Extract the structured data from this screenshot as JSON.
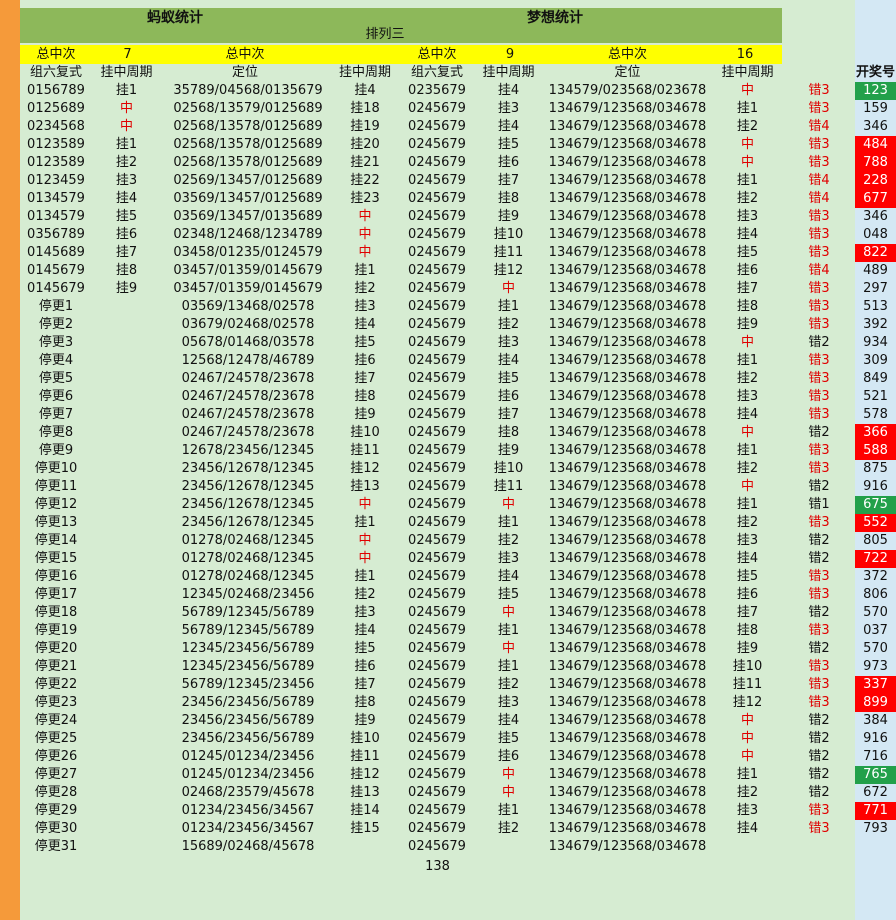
{
  "header": {
    "left_title": "蚂蚁统计",
    "right_title": "梦想统计",
    "subtitle": "排列三"
  },
  "summary": {
    "left_label": "总中次",
    "left_count": "7",
    "mid_label": "总中次",
    "right_label": "总中次",
    "right_count": "9",
    "far_label": "总中次",
    "far_count": "16"
  },
  "columns": {
    "ant_combo": "组六复式",
    "ant_cycle": "挂中周期",
    "ant_position": "定位",
    "ant_pos_cycle": "挂中周期",
    "dream_combo": "组六复式",
    "dream_cycle": "挂中周期",
    "dream_position": "定位",
    "dream_pos_cycle": "挂中周期",
    "result": "开奖号"
  },
  "rows": [
    {
      "a": "0156789",
      "b": "挂1",
      "c": "35789/04568/0135679",
      "d": "挂4",
      "e": "0235679",
      "f": "挂4",
      "g": "134579/023568/023678",
      "h": "中",
      "i": "错3",
      "r": "123",
      "rs": "g"
    },
    {
      "a": "0125689",
      "b": "中",
      "c": "02568/13579/0125689",
      "d": "挂18",
      "e": "0245679",
      "f": "挂3",
      "g": "134679/123568/034678",
      "h": "挂1",
      "i": "错3",
      "r": "159",
      "rs": ""
    },
    {
      "a": "0234568",
      "b": "中",
      "c": "02568/13578/0125689",
      "d": "挂19",
      "e": "0245679",
      "f": "挂4",
      "g": "134679/123568/034678",
      "h": "挂2",
      "i": "错4",
      "r": "346",
      "rs": ""
    },
    {
      "a": "0123589",
      "b": "挂1",
      "c": "02568/13578/0125689",
      "d": "挂20",
      "e": "0245679",
      "f": "挂5",
      "g": "134679/123568/034678",
      "h": "中",
      "i": "错3",
      "r": "484",
      "rs": "r"
    },
    {
      "a": "0123589",
      "b": "挂2",
      "c": "02568/13578/0125689",
      "d": "挂21",
      "e": "0245679",
      "f": "挂6",
      "g": "134679/123568/034678",
      "h": "中",
      "i": "错3",
      "r": "788",
      "rs": "r"
    },
    {
      "a": "0123459",
      "b": "挂3",
      "c": "02569/13457/0125689",
      "d": "挂22",
      "e": "0245679",
      "f": "挂7",
      "g": "134679/123568/034678",
      "h": "挂1",
      "i": "错4",
      "r": "228",
      "rs": "r"
    },
    {
      "a": "0134579",
      "b": "挂4",
      "c": "03569/13457/0125689",
      "d": "挂23",
      "e": "0245679",
      "f": "挂8",
      "g": "134679/123568/034678",
      "h": "挂2",
      "i": "错4",
      "r": "677",
      "rs": "r"
    },
    {
      "a": "0134579",
      "b": "挂5",
      "c": "03569/13457/0135689",
      "d": "中",
      "e": "0245679",
      "f": "挂9",
      "g": "134679/123568/034678",
      "h": "挂3",
      "i": "错3",
      "r": "346",
      "rs": ""
    },
    {
      "a": "0356789",
      "b": "挂6",
      "c": "02348/12468/1234789",
      "d": "中",
      "e": "0245679",
      "f": "挂10",
      "g": "134679/123568/034678",
      "h": "挂4",
      "i": "错3",
      "r": "048",
      "rs": ""
    },
    {
      "a": "0145689",
      "b": "挂7",
      "c": "03458/01235/0124579",
      "d": "中",
      "e": "0245679",
      "f": "挂11",
      "g": "134679/123568/034678",
      "h": "挂5",
      "i": "错3",
      "r": "822",
      "rs": "r"
    },
    {
      "a": "0145679",
      "b": "挂8",
      "c": "03457/01359/0145679",
      "d": "挂1",
      "e": "0245679",
      "f": "挂12",
      "g": "134679/123568/034678",
      "h": "挂6",
      "i": "错4",
      "r": "489",
      "rs": ""
    },
    {
      "a": "0145679",
      "b": "挂9",
      "c": "03457/01359/0145679",
      "d": "挂2",
      "e": "0245679",
      "f": "中",
      "g": "134679/123568/034678",
      "h": "挂7",
      "i": "错3",
      "r": "297",
      "rs": ""
    },
    {
      "a": "停更1",
      "b": "",
      "c": "03569/13468/02578",
      "d": "挂3",
      "e": "0245679",
      "f": "挂1",
      "g": "134679/123568/034678",
      "h": "挂8",
      "i": "错3",
      "r": "513",
      "rs": ""
    },
    {
      "a": "停更2",
      "b": "",
      "c": "03679/02468/02578",
      "d": "挂4",
      "e": "0245679",
      "f": "挂2",
      "g": "134679/123568/034678",
      "h": "挂9",
      "i": "错3",
      "r": "392",
      "rs": ""
    },
    {
      "a": "停更3",
      "b": "",
      "c": "05678/01468/03578",
      "d": "挂5",
      "e": "0245679",
      "f": "挂3",
      "g": "134679/123568/034678",
      "h": "中",
      "i": "错2",
      "r": "934",
      "rs": ""
    },
    {
      "a": "停更4",
      "b": "",
      "c": "12568/12478/46789",
      "d": "挂6",
      "e": "0245679",
      "f": "挂4",
      "g": "134679/123568/034678",
      "h": "挂1",
      "i": "错3",
      "r": "309",
      "rs": ""
    },
    {
      "a": "停更5",
      "b": "",
      "c": "02467/24578/23678",
      "d": "挂7",
      "e": "0245679",
      "f": "挂5",
      "g": "134679/123568/034678",
      "h": "挂2",
      "i": "错3",
      "r": "849",
      "rs": ""
    },
    {
      "a": "停更6",
      "b": "",
      "c": "02467/24578/23678",
      "d": "挂8",
      "e": "0245679",
      "f": "挂6",
      "g": "134679/123568/034678",
      "h": "挂3",
      "i": "错3",
      "r": "521",
      "rs": ""
    },
    {
      "a": "停更7",
      "b": "",
      "c": "02467/24578/23678",
      "d": "挂9",
      "e": "0245679",
      "f": "挂7",
      "g": "134679/123568/034678",
      "h": "挂4",
      "i": "错3",
      "r": "578",
      "rs": ""
    },
    {
      "a": "停更8",
      "b": "",
      "c": "02467/24578/23678",
      "d": "挂10",
      "e": "0245679",
      "f": "挂8",
      "g": "134679/123568/034678",
      "h": "中",
      "i": "错2",
      "r": "366",
      "rs": "r"
    },
    {
      "a": "停更9",
      "b": "",
      "c": "12678/23456/12345",
      "d": "挂11",
      "e": "0245679",
      "f": "挂9",
      "g": "134679/123568/034678",
      "h": "挂1",
      "i": "错3",
      "r": "588",
      "rs": "r"
    },
    {
      "a": "停更10",
      "b": "",
      "c": "23456/12678/12345",
      "d": "挂12",
      "e": "0245679",
      "f": "挂10",
      "g": "134679/123568/034678",
      "h": "挂2",
      "i": "错3",
      "r": "875",
      "rs": ""
    },
    {
      "a": "停更11",
      "b": "",
      "c": "23456/12678/12345",
      "d": "挂13",
      "e": "0245679",
      "f": "挂11",
      "g": "134679/123568/034678",
      "h": "中",
      "i": "错2",
      "r": "916",
      "rs": ""
    },
    {
      "a": "停更12",
      "b": "",
      "c": "23456/12678/12345",
      "d": "中",
      "e": "0245679",
      "f": "中",
      "g": "134679/123568/034678",
      "h": "挂1",
      "i": "错1",
      "r": "675",
      "rs": "g"
    },
    {
      "a": "停更13",
      "b": "",
      "c": "23456/12678/12345",
      "d": "挂1",
      "e": "0245679",
      "f": "挂1",
      "g": "134679/123568/034678",
      "h": "挂2",
      "i": "错3",
      "r": "552",
      "rs": "r"
    },
    {
      "a": "停更14",
      "b": "",
      "c": "01278/02468/12345",
      "d": "中",
      "e": "0245679",
      "f": "挂2",
      "g": "134679/123568/034678",
      "h": "挂3",
      "i": "错2",
      "r": "805",
      "rs": ""
    },
    {
      "a": "停更15",
      "b": "",
      "c": "01278/02468/12345",
      "d": "中",
      "e": "0245679",
      "f": "挂3",
      "g": "134679/123568/034678",
      "h": "挂4",
      "i": "错2",
      "r": "722",
      "rs": "r"
    },
    {
      "a": "停更16",
      "b": "",
      "c": "01278/02468/12345",
      "d": "挂1",
      "e": "0245679",
      "f": "挂4",
      "g": "134679/123568/034678",
      "h": "挂5",
      "i": "错3",
      "r": "372",
      "rs": ""
    },
    {
      "a": "停更17",
      "b": "",
      "c": "12345/02468/23456",
      "d": "挂2",
      "e": "0245679",
      "f": "挂5",
      "g": "134679/123568/034678",
      "h": "挂6",
      "i": "错3",
      "r": "806",
      "rs": ""
    },
    {
      "a": "停更18",
      "b": "",
      "c": "56789/12345/56789",
      "d": "挂3",
      "e": "0245679",
      "f": "中",
      "g": "134679/123568/034678",
      "h": "挂7",
      "i": "错2",
      "r": "570",
      "rs": ""
    },
    {
      "a": "停更19",
      "b": "",
      "c": "56789/12345/56789",
      "d": "挂4",
      "e": "0245679",
      "f": "挂1",
      "g": "134679/123568/034678",
      "h": "挂8",
      "i": "错3",
      "r": "037",
      "rs": ""
    },
    {
      "a": "停更20",
      "b": "",
      "c": "12345/23456/56789",
      "d": "挂5",
      "e": "0245679",
      "f": "中",
      "g": "134679/123568/034678",
      "h": "挂9",
      "i": "错2",
      "r": "570",
      "rs": ""
    },
    {
      "a": "停更21",
      "b": "",
      "c": "12345/23456/56789",
      "d": "挂6",
      "e": "0245679",
      "f": "挂1",
      "g": "134679/123568/034678",
      "h": "挂10",
      "i": "错3",
      "r": "973",
      "rs": ""
    },
    {
      "a": "停更22",
      "b": "",
      "c": "56789/12345/23456",
      "d": "挂7",
      "e": "0245679",
      "f": "挂2",
      "g": "134679/123568/034678",
      "h": "挂11",
      "i": "错3",
      "r": "337",
      "rs": "r"
    },
    {
      "a": "停更23",
      "b": "",
      "c": "23456/23456/56789",
      "d": "挂8",
      "e": "0245679",
      "f": "挂3",
      "g": "134679/123568/034678",
      "h": "挂12",
      "i": "错3",
      "r": "899",
      "rs": "r"
    },
    {
      "a": "停更24",
      "b": "",
      "c": "23456/23456/56789",
      "d": "挂9",
      "e": "0245679",
      "f": "挂4",
      "g": "134679/123568/034678",
      "h": "中",
      "i": "错2",
      "r": "384",
      "rs": ""
    },
    {
      "a": "停更25",
      "b": "",
      "c": "23456/23456/56789",
      "d": "挂10",
      "e": "0245679",
      "f": "挂5",
      "g": "134679/123568/034678",
      "h": "中",
      "i": "错2",
      "r": "916",
      "rs": ""
    },
    {
      "a": "停更26",
      "b": "",
      "c": "01245/01234/23456",
      "d": "挂11",
      "e": "0245679",
      "f": "挂6",
      "g": "134679/123568/034678",
      "h": "中",
      "i": "错2",
      "r": "716",
      "rs": ""
    },
    {
      "a": "停更27",
      "b": "",
      "c": "01245/01234/23456",
      "d": "挂12",
      "e": "0245679",
      "f": "中",
      "g": "134679/123568/034678",
      "h": "挂1",
      "i": "错2",
      "r": "765",
      "rs": "g"
    },
    {
      "a": "停更28",
      "b": "",
      "c": "02468/23579/45678",
      "d": "挂13",
      "e": "0245679",
      "f": "中",
      "g": "134679/123568/034678",
      "h": "挂2",
      "i": "错2",
      "r": "672",
      "rs": ""
    },
    {
      "a": "停更29",
      "b": "",
      "c": "01234/23456/34567",
      "d": "挂14",
      "e": "0245679",
      "f": "挂1",
      "g": "134679/123568/034678",
      "h": "挂3",
      "i": "错3",
      "r": "771",
      "rs": "r"
    },
    {
      "a": "停更30",
      "b": "",
      "c": "01234/23456/34567",
      "d": "挂15",
      "e": "0245679",
      "f": "挂2",
      "g": "134679/123568/034678",
      "h": "挂4",
      "i": "错3",
      "r": "793",
      "rs": ""
    },
    {
      "a": "停更31",
      "b": "",
      "c": "15689/02468/45678",
      "d": "",
      "e": "0245679",
      "f": "",
      "g": "134679/123568/034678",
      "h": "",
      "i": "",
      "r": "",
      "rs": ""
    }
  ],
  "footer_count": "138",
  "colors": {
    "hit": "#e00000",
    "error": "#e00000",
    "result_red": "#ff0000",
    "result_green": "#22a04a"
  }
}
